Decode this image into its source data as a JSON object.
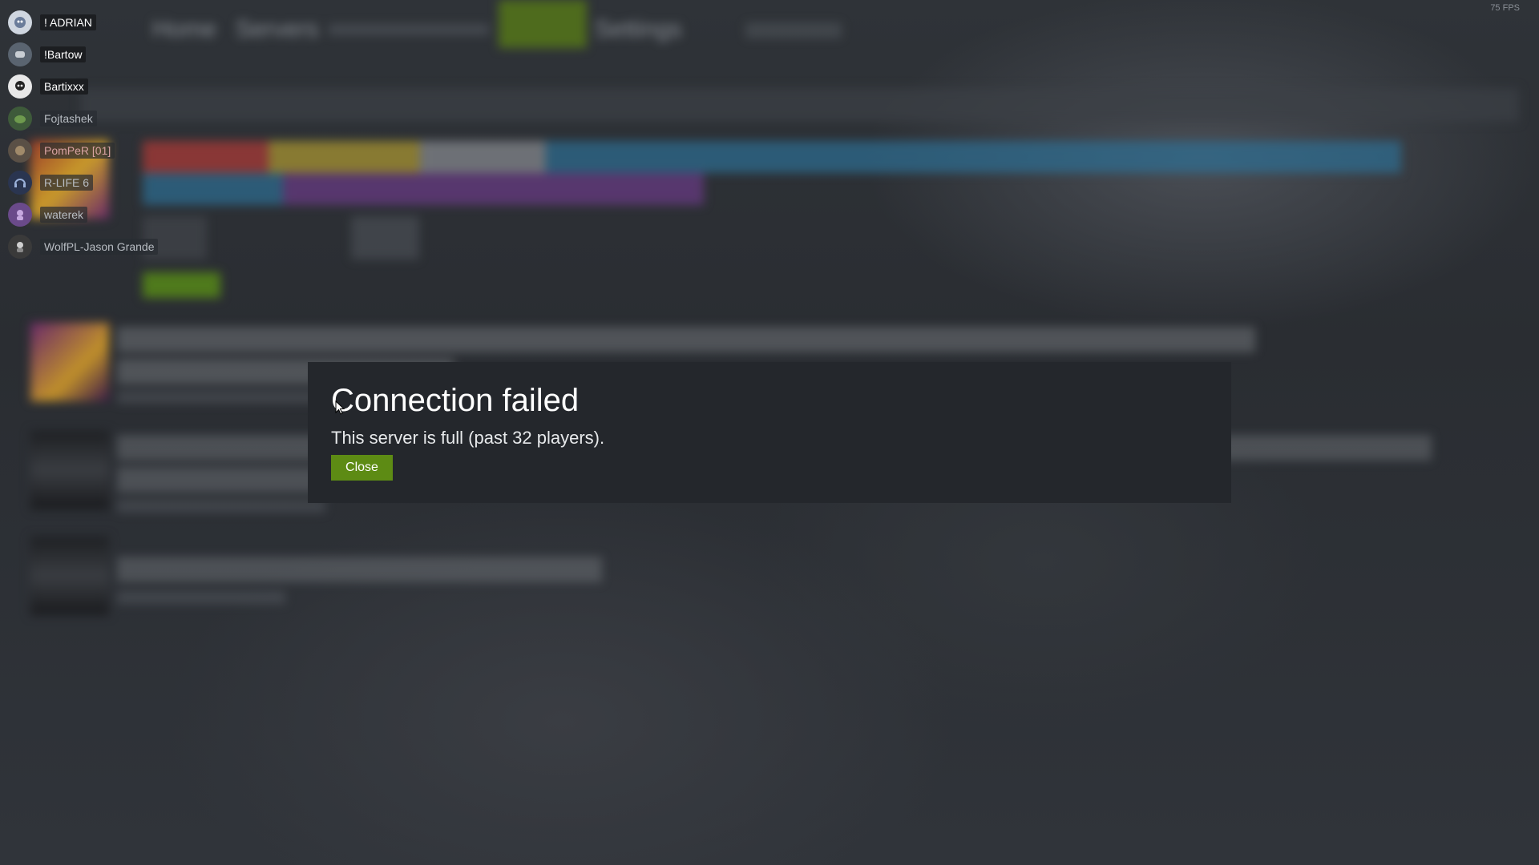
{
  "fps": "75 FPS",
  "friends": [
    {
      "name": "! ADRIAN",
      "status": "online"
    },
    {
      "name": "!Bartow",
      "status": "online"
    },
    {
      "name": "Bartixxx",
      "status": "online"
    },
    {
      "name": "Fojtashek",
      "status": "away"
    },
    {
      "name": "PomPeR [01]",
      "status": "away"
    },
    {
      "name": "R-LIFE 6",
      "status": "away"
    },
    {
      "name": "waterek",
      "status": "away"
    },
    {
      "name": "WolfPL-Jason Grande",
      "status": "away"
    }
  ],
  "nav": {
    "home": "Home",
    "servers": "Servers",
    "settings": "Settings"
  },
  "dialog": {
    "title": "Connection failed",
    "message": "This server is full (past 32 players).",
    "close_label": "Close"
  },
  "colors": {
    "accent": "#5d8b14",
    "modal_bg": "#24272c"
  }
}
